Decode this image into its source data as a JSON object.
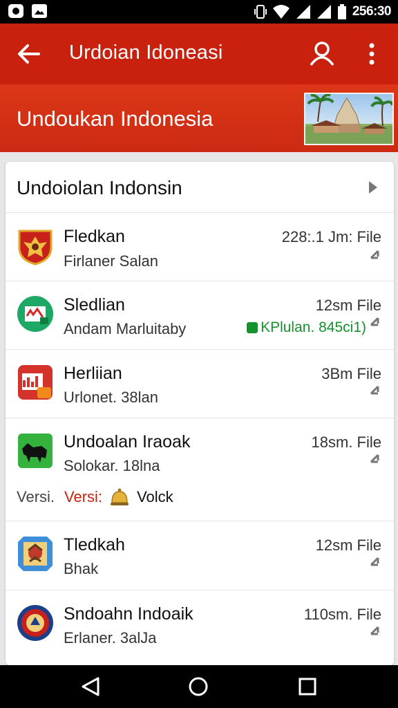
{
  "status": {
    "time": "256:30"
  },
  "appbar": {
    "title": "Urdoian Idoneasi"
  },
  "hero": {
    "title": "Undoukan Indonesia"
  },
  "section": {
    "title": "Undoiolan Indonsin"
  },
  "items": [
    {
      "name": "Fledkan",
      "sub": "Firlaner Salan",
      "size": "228:.1 Jm: File",
      "icon": "garuda-shield-icon"
    },
    {
      "name": "Sledlian",
      "sub": "Andam Marluitaby",
      "size": "12sm File",
      "badge": "KPlulan. 845ci1)",
      "icon": "green-app-icon"
    },
    {
      "name": "Herliian",
      "sub": "Urlonet. 38lan",
      "size": "3Bm File",
      "icon": "chart-app-icon"
    },
    {
      "name": "Undoalan Iraoak",
      "sub": "Solokar. 18lna",
      "size": "18sm. File",
      "icon": "bull-app-icon",
      "version": {
        "label1": "Versi.",
        "label2": "Versi:",
        "label3": "Volck"
      }
    },
    {
      "name": "Tledkah",
      "sub": "Bhak",
      "size": "12sm File",
      "icon": "emblem-map-icon"
    },
    {
      "name": "Sndoahn Indoaik",
      "sub": "Erlaner. 3alJa",
      "size": "110sm. File",
      "icon": "round-emblem-icon"
    }
  ],
  "colors": {
    "primary": "#c8220f",
    "accent_green": "#14922e"
  }
}
